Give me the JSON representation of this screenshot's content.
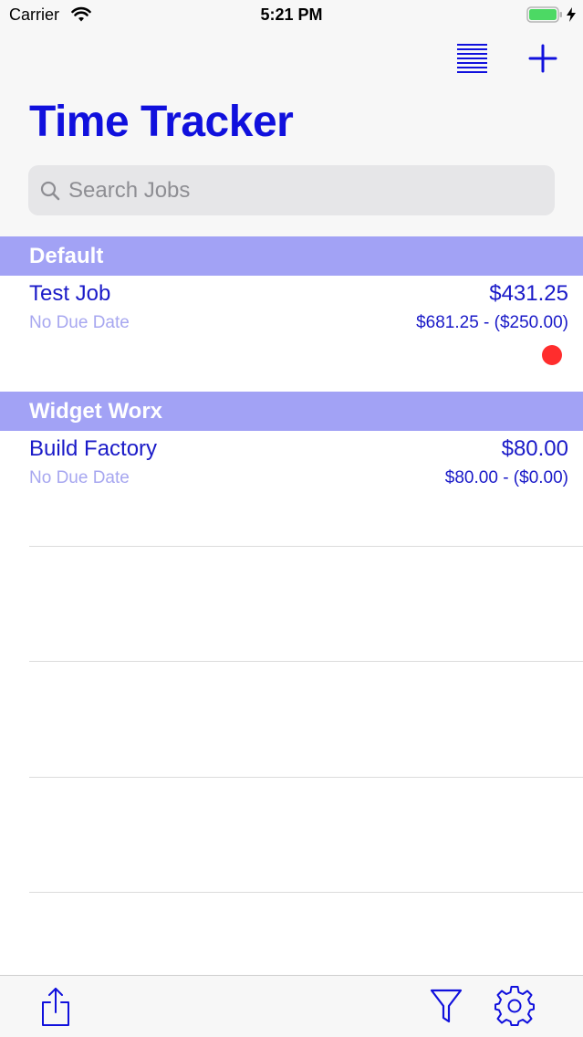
{
  "status_bar": {
    "carrier": "Carrier",
    "time": "5:21 PM",
    "battery_color": "#4cd964"
  },
  "nav": {
    "title": "Time Tracker",
    "accent_color": "#1010dd",
    "icons": [
      "list-icon",
      "add-icon"
    ]
  },
  "search": {
    "placeholder": "Search Jobs",
    "value": ""
  },
  "sections": [
    {
      "header": "Default",
      "jobs": [
        {
          "name": "Test Job",
          "due": "No Due Date",
          "total": "$431.25",
          "breakdown": "$681.25 - ($250.00)",
          "has_alert": true,
          "alert_color": "#ff2d2d"
        }
      ]
    },
    {
      "header": "Widget Worx",
      "jobs": [
        {
          "name": "Build Factory",
          "due": "No Due Date",
          "total": "$80.00",
          "breakdown": "$80.00 - ($0.00)",
          "has_alert": false
        }
      ]
    }
  ],
  "section_header_color": "#a2a2f5",
  "toolbar": {
    "icons": [
      "share-icon",
      "filter-icon",
      "settings-icon"
    ]
  }
}
